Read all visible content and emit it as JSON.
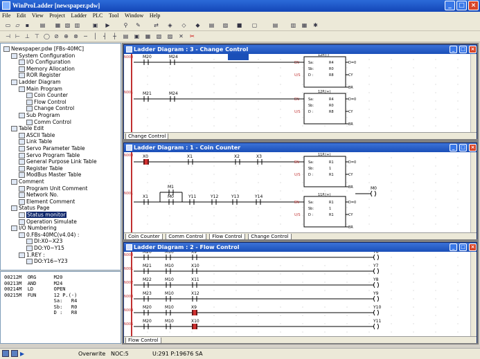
{
  "app": {
    "title": "WinProLadder [newspaper.pdw]"
  },
  "menu": [
    "File",
    "Edit",
    "View",
    "Project",
    "Ladder",
    "PLC",
    "Tool",
    "Window",
    "Help"
  ],
  "tree": [
    {
      "label": "Newspaper.pdw [FBs-40MC]",
      "level": 0
    },
    {
      "label": "System Configuration",
      "level": 1
    },
    {
      "label": "I/O Configuration",
      "level": 2
    },
    {
      "label": "Memory Allocation",
      "level": 2
    },
    {
      "label": "ROR Register",
      "level": 2
    },
    {
      "label": "Ladder Diagram",
      "level": 1
    },
    {
      "label": "Main Program",
      "level": 2
    },
    {
      "label": "Coin Counter",
      "level": 3
    },
    {
      "label": "Flow Control",
      "level": 3
    },
    {
      "label": "Change Control",
      "level": 3
    },
    {
      "label": "Sub Program",
      "level": 2
    },
    {
      "label": "Comm Control",
      "level": 3
    },
    {
      "label": "Table Edit",
      "level": 1
    },
    {
      "label": "ASCII Table",
      "level": 2
    },
    {
      "label": "Link Table",
      "level": 2
    },
    {
      "label": "Servo Parameter Table",
      "level": 2
    },
    {
      "label": "Servo Program Table",
      "level": 2
    },
    {
      "label": "General Purpose Link Table",
      "level": 2
    },
    {
      "label": "Register Table",
      "level": 2
    },
    {
      "label": "ModBus Master Table",
      "level": 2
    },
    {
      "label": "Comment",
      "level": 1
    },
    {
      "label": "Program Unit Comment",
      "level": 2
    },
    {
      "label": "Network No.",
      "level": 2
    },
    {
      "label": "Element Comment",
      "level": 2
    },
    {
      "label": "Status Page",
      "level": 1
    },
    {
      "label": "Status monitor",
      "level": 2,
      "selected": true
    },
    {
      "label": "Operation Simulate",
      "level": 2
    },
    {
      "label": "I/O Numbering",
      "level": 1
    },
    {
      "label": "0.FBs-40MC(v4.04) :",
      "level": 2
    },
    {
      "label": "DI:X0~X23",
      "level": 3
    },
    {
      "label": "DO:Y0~Y15",
      "level": 3
    },
    {
      "label": "1.REY :",
      "level": 2
    },
    {
      "label": "DO:Y16~Y23",
      "level": 3
    }
  ],
  "code": [
    "00212M  ORG      M20",
    "00213M  AND      M24",
    "00214M  LD       OPEN",
    "00215M  FUN      12 P.(-)",
    "                 Sa:   R4",
    "                 Sb:   R0",
    "                 D :   R8"
  ],
  "windows": {
    "w3": {
      "title": "Ladder Diagram : 3 - Change Control",
      "tabs": [
        "Change Control"
      ],
      "addrs": [
        "N000",
        "N001"
      ],
      "rungs": [
        {
          "contacts": [
            "M20",
            "M24"
          ],
          "fun": "12P.(-)",
          "params": [
            [
              "Sa:",
              "R4"
            ],
            [
              "Sb:",
              "R0"
            ],
            [
              "D :",
              "R8"
            ]
          ],
          "outs": [
            "D=0",
            "CY",
            "BR"
          ],
          "ins": [
            "EN",
            "U/S"
          ]
        },
        {
          "contacts": [
            "M21",
            "M24"
          ],
          "fun": "12P.(+)",
          "params": [
            [
              "Sa:",
              "R4"
            ],
            [
              "Sb:",
              "R0"
            ],
            [
              "D :",
              "R8"
            ]
          ],
          "outs": [
            "D=0",
            "CY",
            "BR"
          ],
          "ins": [
            "EN",
            "U/S"
          ]
        }
      ]
    },
    "w1": {
      "title": "Ladder Diagram : 1 - Coin Counter",
      "tabs": [
        "Coin Counter",
        "Comm Control",
        "Flow Control",
        "Change Control"
      ],
      "addrs": [
        "N000",
        "N001"
      ],
      "rung1": {
        "contacts": [
          "X0",
          "X1",
          "X2",
          "X3"
        ],
        "fun": "11P.(+)",
        "params": [
          [
            "Sa:",
            "R1"
          ],
          [
            "Sb:",
            "1"
          ],
          [
            "D :",
            "R1"
          ]
        ],
        "outs": [
          "D=0",
          "CY",
          "BR"
        ],
        "ins": [
          "EN",
          "U/S"
        ],
        "coil": "M0"
      },
      "rung2": {
        "contacts": [
          "X1",
          "M0",
          "Y11",
          "Y12",
          "Y13",
          "Y14"
        ],
        "branch": "M1",
        "fun": "11P.(+)",
        "params": [
          [
            "Sa:",
            "R1"
          ],
          [
            "Sb:",
            "1"
          ],
          [
            "D :",
            "R1"
          ]
        ],
        "outs": [
          "D=0",
          "CY",
          "BR"
        ],
        "ins": [
          "EN",
          "U/S"
        ]
      }
    },
    "w2": {
      "title": "Ladder Diagram : 2 - Flow Control",
      "tabs": [
        "Flow Control"
      ],
      "addrs": [
        "N000",
        "N001",
        "N002",
        "N003",
        "N004",
        "N005"
      ],
      "rungs": [
        {
          "contacts": [
            "M20",
            "M10",
            "X9"
          ],
          "coil": "Y6"
        },
        {
          "contacts": [
            "M21",
            "M10",
            "X10"
          ],
          "coil": "Y7"
        },
        {
          "contacts": [
            "M22",
            "M10",
            "X11"
          ],
          "coil": "Y8"
        },
        {
          "contacts": [
            "M23",
            "M10",
            "X12"
          ],
          "coil": "Y9"
        },
        {
          "contacts": [
            "M20",
            "M10",
            "X9"
          ],
          "coil": "Y10"
        },
        {
          "contacts": [
            "M20",
            "M10",
            "X10"
          ],
          "coil": "Y11"
        }
      ]
    }
  },
  "status": {
    "mode": "Overwrite",
    "noc": "NOC:5",
    "position": "U:291 P:19676 SA"
  },
  "colors": {
    "titlebar": "#1a4fb8",
    "selection": "#0a246a",
    "rail": "#c03030",
    "active_contact": "#d03030"
  }
}
